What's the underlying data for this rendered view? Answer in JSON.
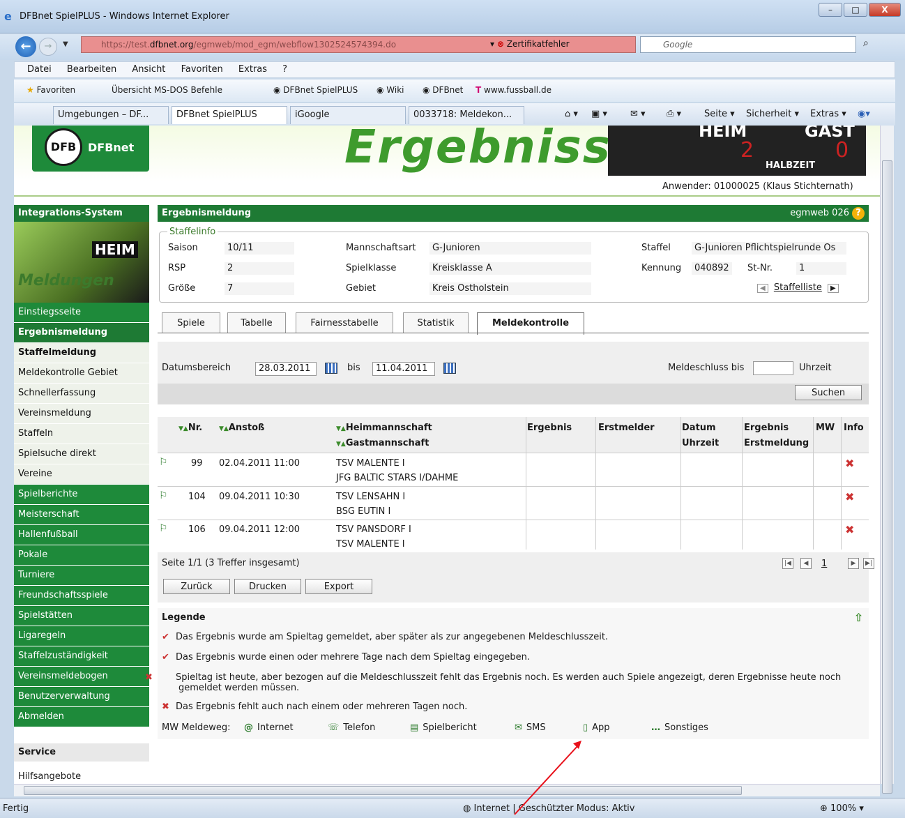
{
  "window": {
    "title": "DFBnet SpielPLUS - Windows Internet Explorer",
    "url_prefix": "https://test.",
    "url_host": "dfbnet.org",
    "url_path": "/egmweb/mod_egm/webflow1302524574394.do",
    "cert_error": "Zertifikatfehler",
    "search_placeholder": "Google",
    "minimize": "–",
    "maximize": "□",
    "close": "X"
  },
  "menu": [
    "Datei",
    "Bearbeiten",
    "Ansicht",
    "Favoriten",
    "Extras",
    "?"
  ],
  "favorites": {
    "label": "Favoriten",
    "items": [
      "Übersicht MS-DOS Befehle",
      "DFBnet SpielPLUS",
      "Wiki",
      "DFBnet",
      "www.fussball.de"
    ]
  },
  "browser_tabs": [
    "Umgebungen – DF...",
    "DFBnet SpielPLUS",
    "iGoogle",
    "0033718: Meldekon..."
  ],
  "commandbar": {
    "seite": "Seite ▾",
    "sicherheit": "Sicherheit ▾",
    "extras": "Extras ▾"
  },
  "banner": {
    "logo_text": "DFBnet",
    "headline": "Ergebnisse",
    "score_heim": "HEIM",
    "score_gast": "GAST",
    "score_halbzeit": "HALBZEIT",
    "score_h": "2",
    "score_g": "0",
    "anwender": "Anwender: 01000025 (Klaus Stichternath)"
  },
  "sidebar": {
    "header": "Integrations-System",
    "image_text": "Meldungen",
    "image_heim": "HEIM",
    "items": [
      {
        "label": "Einstiegsseite",
        "style": "green"
      },
      {
        "label": "Ergebnismeldung",
        "style": "dark"
      },
      {
        "label": "Staffelmeldung",
        "style": "white-bold"
      },
      {
        "label": "Meldekontrolle Gebiet",
        "style": "white"
      },
      {
        "label": "Schnellerfassung",
        "style": "white"
      },
      {
        "label": "Vereinsmeldung",
        "style": "white"
      },
      {
        "label": "Staffeln",
        "style": "white"
      },
      {
        "label": "Spielsuche direkt",
        "style": "white"
      },
      {
        "label": "Vereine",
        "style": "white"
      },
      {
        "label": "Spielberichte",
        "style": "green"
      },
      {
        "label": "Meisterschaft",
        "style": "green"
      },
      {
        "label": "Hallenfußball",
        "style": "green"
      },
      {
        "label": "Pokale",
        "style": "green"
      },
      {
        "label": "Turniere",
        "style": "green"
      },
      {
        "label": "Freundschaftsspiele",
        "style": "green"
      },
      {
        "label": "Spielstätten",
        "style": "green"
      },
      {
        "label": "Ligaregeln",
        "style": "green"
      },
      {
        "label": "Staffelzuständigkeit",
        "style": "green"
      },
      {
        "label": "Vereinsmeldebogen",
        "style": "green"
      },
      {
        "label": "Benutzerverwaltung",
        "style": "green"
      },
      {
        "label": "Abmelden",
        "style": "green"
      }
    ],
    "service": "Service",
    "hilfe": "Hilfsangebote"
  },
  "main": {
    "title": "Ergebnismeldung",
    "module": "egmweb 026",
    "staffelinfo_label": "Staffelinfo",
    "info": {
      "saison_label": "Saison",
      "saison": "10/11",
      "rsp_label": "RSP",
      "rsp": "2",
      "groesse_label": "Größe",
      "groesse": "7",
      "mannschaftsart_label": "Mannschaftsart",
      "mannschaftsart": "G-Junioren",
      "spielklasse_label": "Spielklasse",
      "spielklasse": "Kreisklasse A",
      "gebiet_label": "Gebiet",
      "gebiet": "Kreis Ostholstein",
      "staffel_label": "Staffel",
      "staffel": "G-Junioren Pflichtspielrunde Os",
      "kennung_label": "Kennung",
      "kennung": "040892",
      "stnr_label": "St-Nr.",
      "stnr": "1",
      "staffelliste": "Staffelliste"
    },
    "tabs": [
      "Spiele",
      "Tabelle",
      "Fairnesstabelle",
      "Statistik",
      "Meldekontrolle"
    ],
    "filter": {
      "datumsbereich": "Datumsbereich",
      "von": "28.03.2011",
      "bis_label": "bis",
      "bis": "11.04.2011",
      "meldeschluss": "Meldeschluss bis",
      "uhrzeit": "Uhrzeit",
      "suchen": "Suchen"
    },
    "table": {
      "headers": {
        "nr": "Nr.",
        "anstoss": "Anstoß",
        "heim": "Heimmannschaft",
        "gast": "Gastmannschaft",
        "ergebnis": "Ergebnis",
        "erstmelder": "Erstmelder",
        "datum": "Datum",
        "uhrzeit": "Uhrzeit",
        "erg_erst1": "Ergebnis",
        "erg_erst2": "Erstmeldung",
        "mw": "MW",
        "info": "Info"
      },
      "rows": [
        {
          "nr": "99",
          "anstoss": "02.04.2011 11:00",
          "heim": "TSV MALENTE I",
          "gast": "JFG BALTIC STARS I/DAHME"
        },
        {
          "nr": "104",
          "anstoss": "09.04.2011 10:30",
          "heim": "TSV LENSAHN I",
          "gast": "BSG EUTIN I"
        },
        {
          "nr": "106",
          "anstoss": "09.04.2011 12:00",
          "heim": "TSV PANSDORF I",
          "gast": "TSV MALENTE I"
        }
      ]
    },
    "pager": {
      "info": "Seite 1/1 (3 Treffer insgesamt)",
      "page": "1"
    },
    "buttons": {
      "zurueck": "Zurück",
      "drucken": "Drucken",
      "export": "Export"
    },
    "legend": {
      "title": "Legende",
      "lines": [
        "Das Ergebnis wurde am Spieltag gemeldet, aber später als zur angegebenen Meldeschlusszeit.",
        "Das Ergebnis wurde einen oder mehrere Tage nach dem Spieltag eingegeben.",
        "Spieltag ist heute, aber bezogen auf die Meldeschlusszeit fehlt das Ergebnis noch. Es werden auch Spiele angezeigt, deren Ergebnisse heute noch gemeldet werden müssen.",
        "Das Ergebnis fehlt auch nach einem oder mehreren Tagen noch."
      ],
      "mw_label": "MW Meldeweg:",
      "mw": [
        "Internet",
        "Telefon",
        "Spielbericht",
        "SMS",
        "App",
        "Sonstiges"
      ]
    }
  },
  "status": {
    "left": "Fertig",
    "zone": "Internet | Geschützter Modus: Aktiv",
    "zoom": "100%"
  },
  "colors": {
    "dfb_green": "#1e8a3a",
    "annotation_arrow": "#e8101a"
  }
}
